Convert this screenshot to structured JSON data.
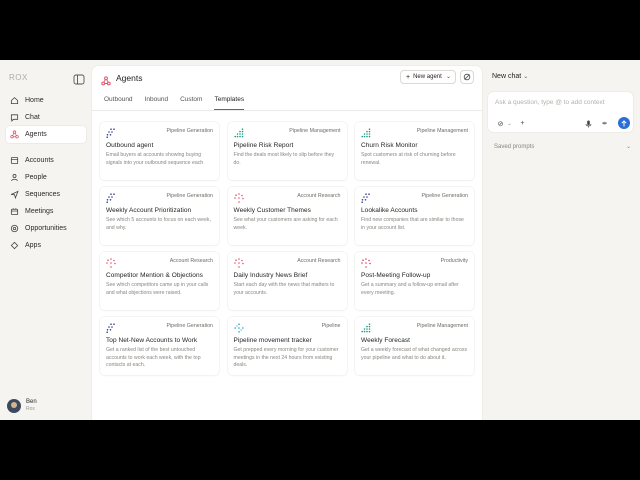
{
  "sidebar": {
    "logo": "ROX",
    "nav_top": [
      {
        "label": "Home",
        "icon": "home-icon"
      },
      {
        "label": "Chat",
        "icon": "chat-icon"
      },
      {
        "label": "Agents",
        "icon": "agents-icon",
        "active": true
      }
    ],
    "nav_bottom": [
      {
        "label": "Accounts",
        "icon": "accounts-icon"
      },
      {
        "label": "People",
        "icon": "people-icon"
      },
      {
        "label": "Sequences",
        "icon": "sequences-icon"
      },
      {
        "label": "Meetings",
        "icon": "meetings-icon"
      },
      {
        "label": "Opportunities",
        "icon": "opportunities-icon"
      },
      {
        "label": "Apps",
        "icon": "apps-icon"
      }
    ],
    "user": {
      "name": "Ben",
      "org": "Rox"
    }
  },
  "header": {
    "title": "Agents",
    "new_agent_label": "New agent"
  },
  "tabs": [
    {
      "label": "Outbound"
    },
    {
      "label": "Inbound"
    },
    {
      "label": "Custom"
    },
    {
      "label": "Templates",
      "active": true
    }
  ],
  "cards": [
    {
      "category": "Pipeline Generation",
      "title": "Outbound agent",
      "desc": "Email buyers at accounts showing buying signals into your outbound sequence each",
      "icon_color": "#2f3d8f",
      "icon": "grid-dots-icon"
    },
    {
      "category": "Pipeline Management",
      "title": "Pipeline Risk Report",
      "desc": "Find the deals most likely to slip before they do.",
      "icon_color": "#1f9c8a",
      "icon": "bars-dots-icon"
    },
    {
      "category": "Pipeline Management",
      "title": "Churn Risk Monitor",
      "desc": "Spot customers at risk of churning before renewal.",
      "icon_color": "#1f9c8a",
      "icon": "bars-dots-icon"
    },
    {
      "category": "Pipeline Generation",
      "title": "Weekly Account Prioritization",
      "desc": "See which 5 accounts to focus on each week, and why.",
      "icon_color": "#2f3d8f",
      "icon": "grid-dots-icon"
    },
    {
      "category": "Account Research",
      "title": "Weekly Customer Themes",
      "desc": "See what your customers are asking for each week.",
      "icon_color": "#e0566a",
      "icon": "ring-dots-icon"
    },
    {
      "category": "Pipeline Generation",
      "title": "Lookalike Accounts",
      "desc": "Find new companies that are similar to those in your account list.",
      "icon_color": "#2f3d8f",
      "icon": "grid-dots-icon"
    },
    {
      "category": "Account Research",
      "title": "Competitor Mention & Objections",
      "desc": "See which competitors came up in your calls and what objections were raised.",
      "icon_color": "#e0566a",
      "icon": "ring-dots-icon"
    },
    {
      "category": "Account Research",
      "title": "Daily Industry News Brief",
      "desc": "Start each day with the news that matters to your accounts.",
      "icon_color": "#e0566a",
      "icon": "ring-dots-icon"
    },
    {
      "category": "Productivity",
      "title": "Post-Meeting Follow-up",
      "desc": "Get a summary and a follow-up email after every meeting.",
      "icon_color": "#d93f5b",
      "icon": "ring-dots-icon"
    },
    {
      "category": "Pipeline Generation",
      "title": "Top Net-New Accounts to Work",
      "desc": "Get a ranked list of the best untouched accounts to work each week, with the top contacts at each.",
      "icon_color": "#2f3d8f",
      "icon": "grid-dots-icon"
    },
    {
      "category": "Pipeline",
      "title": "Pipeline movement tracker",
      "desc": "Get prepped every morning for your customer meetings in the next 24 hours from existing deals.",
      "icon_color": "#2aa7c2",
      "icon": "cross-dots-icon"
    },
    {
      "category": "Pipeline Management",
      "title": "Weekly Forecast",
      "desc": "Get a weekly forecast of what changed across your pipeline and what to do about it.",
      "icon_color": "#1f9c8a",
      "icon": "bars-dots-icon"
    }
  ],
  "chat": {
    "title": "New chat",
    "input_placeholder": "Ask a question, type @ to add context",
    "saved_prompts_label": "Saved prompts"
  },
  "colors": {
    "accent": "#2a6fd6",
    "agents_icon": "#e0566a"
  }
}
